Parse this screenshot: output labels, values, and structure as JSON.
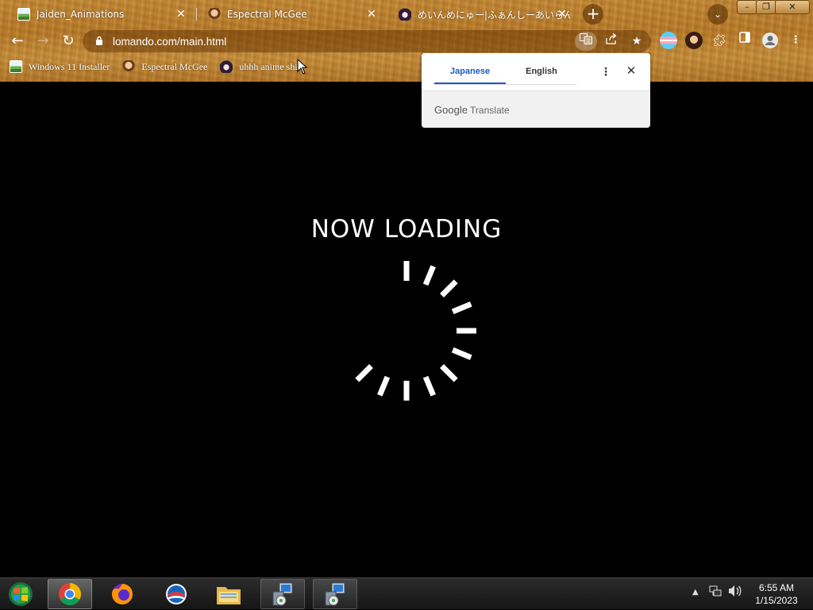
{
  "browser": {
    "tabs": [
      {
        "title": "Jaiden_Animations",
        "favicon": "green-landscape-favicon",
        "active": false
      },
      {
        "title": "Espectral McGee",
        "favicon": "character-favicon",
        "active": false
      },
      {
        "title": "めいんめにゅー|ふぁんしーあいらんど",
        "favicon": "anime-girl-favicon",
        "active": false
      }
    ],
    "new_tab_icon": "plus-icon",
    "tab_search_icon": "chevron-down-icon",
    "window_controls": [
      "minimize",
      "restore",
      "close"
    ],
    "url": "lomando.com/main.html",
    "omnibox_icons": [
      "translate-icon",
      "share-icon",
      "star-icon"
    ],
    "extensions": [
      "trans-flag-extension",
      "avatar-extension",
      "puzzle-extensions-icon",
      "sidepanel-icon",
      "profile-icon",
      "kebab-menu-icon"
    ],
    "bookmarks": [
      {
        "label": "Windows 11 Installer",
        "favicon": "landscape-favicon"
      },
      {
        "label": "Espectral McGee",
        "favicon": "character-favicon"
      },
      {
        "label": "uhhh anime shit",
        "favicon": "anime-girl-favicon"
      }
    ]
  },
  "translate_popup": {
    "languages": [
      "Japanese",
      "English"
    ],
    "selected": "Japanese",
    "brand_google": "Google",
    "brand_translate": "Translate"
  },
  "page": {
    "loading_text": "NOW LOADING",
    "spinner_visible_segments": 11,
    "spinner_total_segments": 16
  },
  "taskbar": {
    "apps": [
      "windows-start",
      "chrome",
      "firefox",
      "outlook",
      "file-explorer",
      "installer-1",
      "installer-2"
    ],
    "active_app": "chrome",
    "time": "6:55 AM",
    "date": "1/15/2023"
  },
  "colors": {
    "chrome_wood": "#bf8534",
    "translate_accent": "#1a5bc4",
    "page_bg": "#000000"
  }
}
